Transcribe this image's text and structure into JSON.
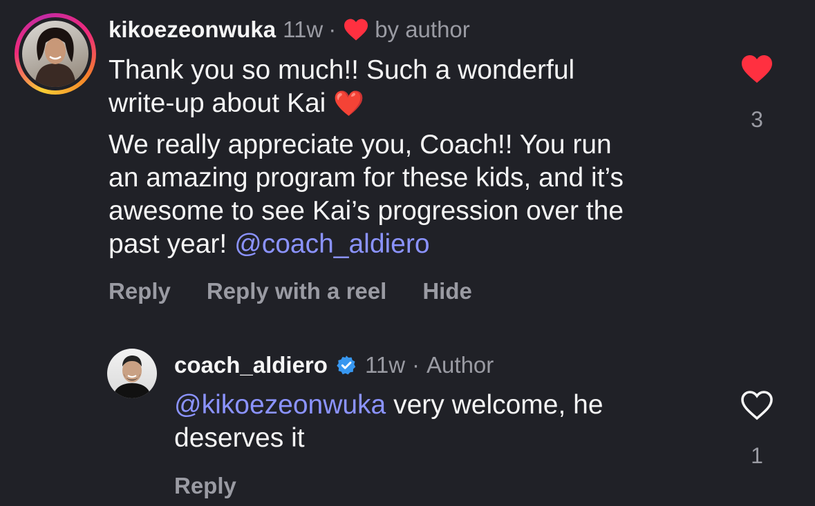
{
  "comments": [
    {
      "username": "kikoezeonwuka",
      "time": "11w",
      "separator": "·",
      "liked_by_author": "by author",
      "line1": "Thank you so much!! Such a wonderful",
      "line2": "write-up about Kai",
      "line2_emoji": "❤️",
      "para2_line1": "We really appreciate you, Coach!! You run",
      "para2_line2": "an amazing program for these kids, and it’s",
      "para2_line3": "awesome to see Kai’s progression over the",
      "para2_line4_prefix": "past year!",
      "para2_mention": "@coach_aldiero",
      "actions": [
        "Reply",
        "Reply with a reel",
        "Hide"
      ],
      "like_count": "3",
      "liked": true
    },
    {
      "username": "coach_aldiero",
      "verified": true,
      "time": "11w",
      "separator": "·",
      "role": "Author",
      "mention": "@kikoezeonwuka",
      "line1_rest": " very welcome, he",
      "line2": "deserves it",
      "actions": [
        "Reply"
      ],
      "like_count": "1",
      "liked": false
    }
  ],
  "colors": {
    "background": "#202127",
    "mention": "#8b93ff",
    "muted": "#9a9ba3",
    "heart_red": "#ff3040",
    "verified_blue": "#3797f0"
  }
}
